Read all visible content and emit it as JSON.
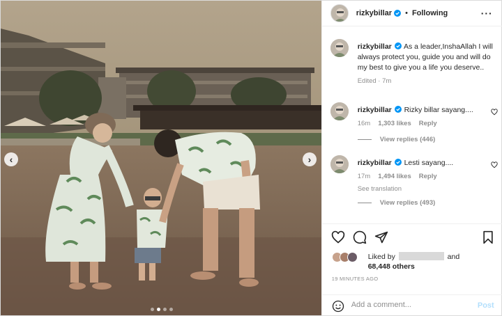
{
  "post": {
    "username": "rizkybillar",
    "verified": true,
    "follow_separator": "•",
    "follow_status": "Following",
    "more_icon": "more-horizontal-icon",
    "carousel": {
      "current_index": 2,
      "total": 4
    },
    "caption": {
      "username": "rizkybillar",
      "text": "As a leader,InshaAllah I will always protect you, guide you and will do my best to give you a life you deserve..",
      "meta": "Edited · 7m"
    },
    "comments": [
      {
        "username": "rizkybillar",
        "text": "Rizky billar sayang....",
        "age": "16m",
        "likes": "1,303 likes",
        "reply_label": "Reply",
        "view_replies": "View replies (446)"
      },
      {
        "username": "rizkybillar",
        "text": "Lesti sayang....",
        "age": "17m",
        "likes": "1,494 likes",
        "reply_label": "Reply",
        "translate": "See translation",
        "view_replies": "View replies (493)"
      }
    ],
    "liked_by_prefix": "Liked by",
    "liked_by_conj": "and",
    "liked_by_others": "68,448 others",
    "time_ago": "19 MINUTES AGO",
    "add_comment_placeholder": "Add a comment...",
    "post_button": "Post"
  },
  "colors": {
    "link_blue": "#0095f6",
    "post_button_disabled": "#b2dffc",
    "muted": "#8e8e8e",
    "text": "#262626"
  }
}
